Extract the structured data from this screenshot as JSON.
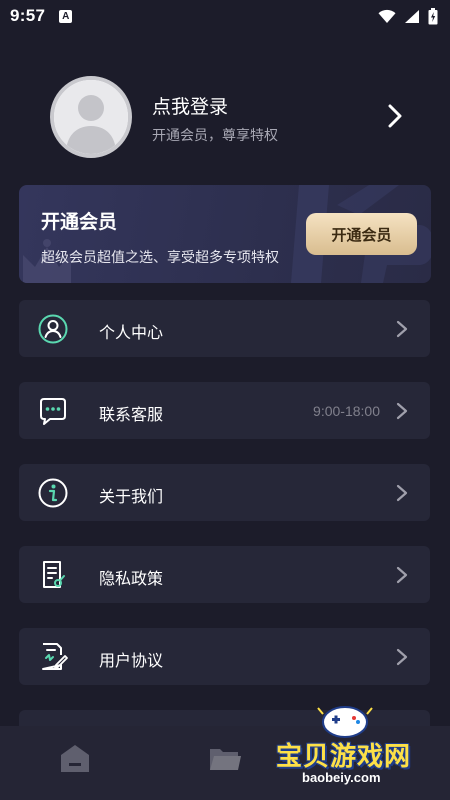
{
  "status_bar": {
    "time": "9:57",
    "notification_badge": "A",
    "icons": [
      "wifi-icon",
      "signal-icon",
      "battery-icon"
    ]
  },
  "profile": {
    "title": "点我登录",
    "subtitle": "开通会员，尊享特权"
  },
  "vip_card": {
    "title": "开通会员",
    "subtitle": "超级会员超值之选、享受超多专项特权",
    "button_label": "开通会员",
    "accent_color": "#e9d2a8"
  },
  "menu": {
    "items": [
      {
        "label": "个人中心",
        "icon": "user-icon",
        "extra": ""
      },
      {
        "label": "联系客服",
        "icon": "chat-icon",
        "extra": "9:00-18:00"
      },
      {
        "label": "关于我们",
        "icon": "info-icon",
        "extra": ""
      },
      {
        "label": "隐私政策",
        "icon": "document-icon",
        "extra": ""
      },
      {
        "label": "用户协议",
        "icon": "agreement-icon",
        "extra": ""
      }
    ]
  },
  "bottom_nav": {
    "items": [
      "home-icon",
      "folder-icon"
    ]
  },
  "watermark": {
    "text": "宝贝游戏网",
    "url": "baobeiy.com"
  },
  "colors": {
    "background": "#1c1c2a",
    "card": "#262738",
    "icon_accent": "#5ad8b0"
  }
}
